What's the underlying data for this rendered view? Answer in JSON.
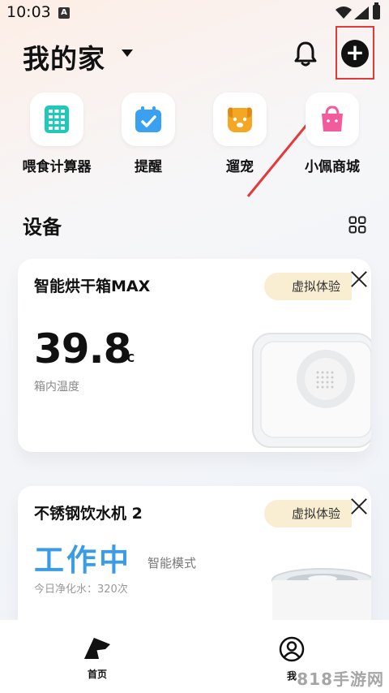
{
  "status_bar": {
    "time": "10:03",
    "notif_badge": "A"
  },
  "header": {
    "title": "我的家"
  },
  "shortcuts": [
    {
      "label": "喂食计算器",
      "icon": "calculator-icon",
      "color": "#1fc9b8"
    },
    {
      "label": "提醒",
      "icon": "calendar-check-icon",
      "color": "#3aa0f2"
    },
    {
      "label": "遛宠",
      "icon": "dog-icon",
      "color": "#f5a623"
    },
    {
      "label": "小佩商城",
      "icon": "shopping-bag-icon",
      "color": "#f25c9c"
    }
  ],
  "devices": {
    "title": "设备",
    "cards": [
      {
        "name": "智能烘干箱MAX",
        "badge": "虚拟体验",
        "temperature": "39.8",
        "unit": "°C",
        "temp_label": "箱内温度"
      },
      {
        "name": "不锈钢饮水机 2",
        "badge": "虚拟体验",
        "status": "工作中",
        "mode": "智能模式",
        "purify": "今日净化水：320次"
      }
    ]
  },
  "nav": {
    "home": "首页",
    "me": "我"
  },
  "watermark": "818手游网",
  "colors": {
    "accent_blue": "#3b9ce6",
    "badge_bg": "#f9edd2",
    "annotation_red": "#e23a3a"
  }
}
